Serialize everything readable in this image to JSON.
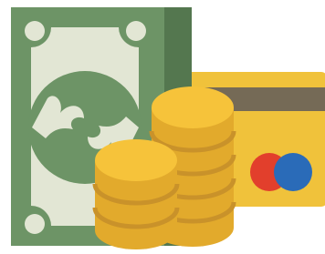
{
  "illustration": {
    "subject_icons": [
      "banknote-stack-icon",
      "credit-card-icon",
      "coin-stack-icon"
    ],
    "colors": {
      "background": "#ffffff",
      "banknote_dark": "#5e8759",
      "banknote_mid": "#6d9466",
      "banknote_back": "#54774f",
      "banknote_light": "#e2e6d4",
      "card_body": "#f0c23b",
      "card_stripe": "#756a56",
      "card_logo_red": "#e23f2c",
      "card_logo_blue": "#2a6bb8",
      "coin_top": "#f6c33a",
      "coin_side": "#e2aa2c",
      "coin_groove": "#c9922a"
    }
  }
}
